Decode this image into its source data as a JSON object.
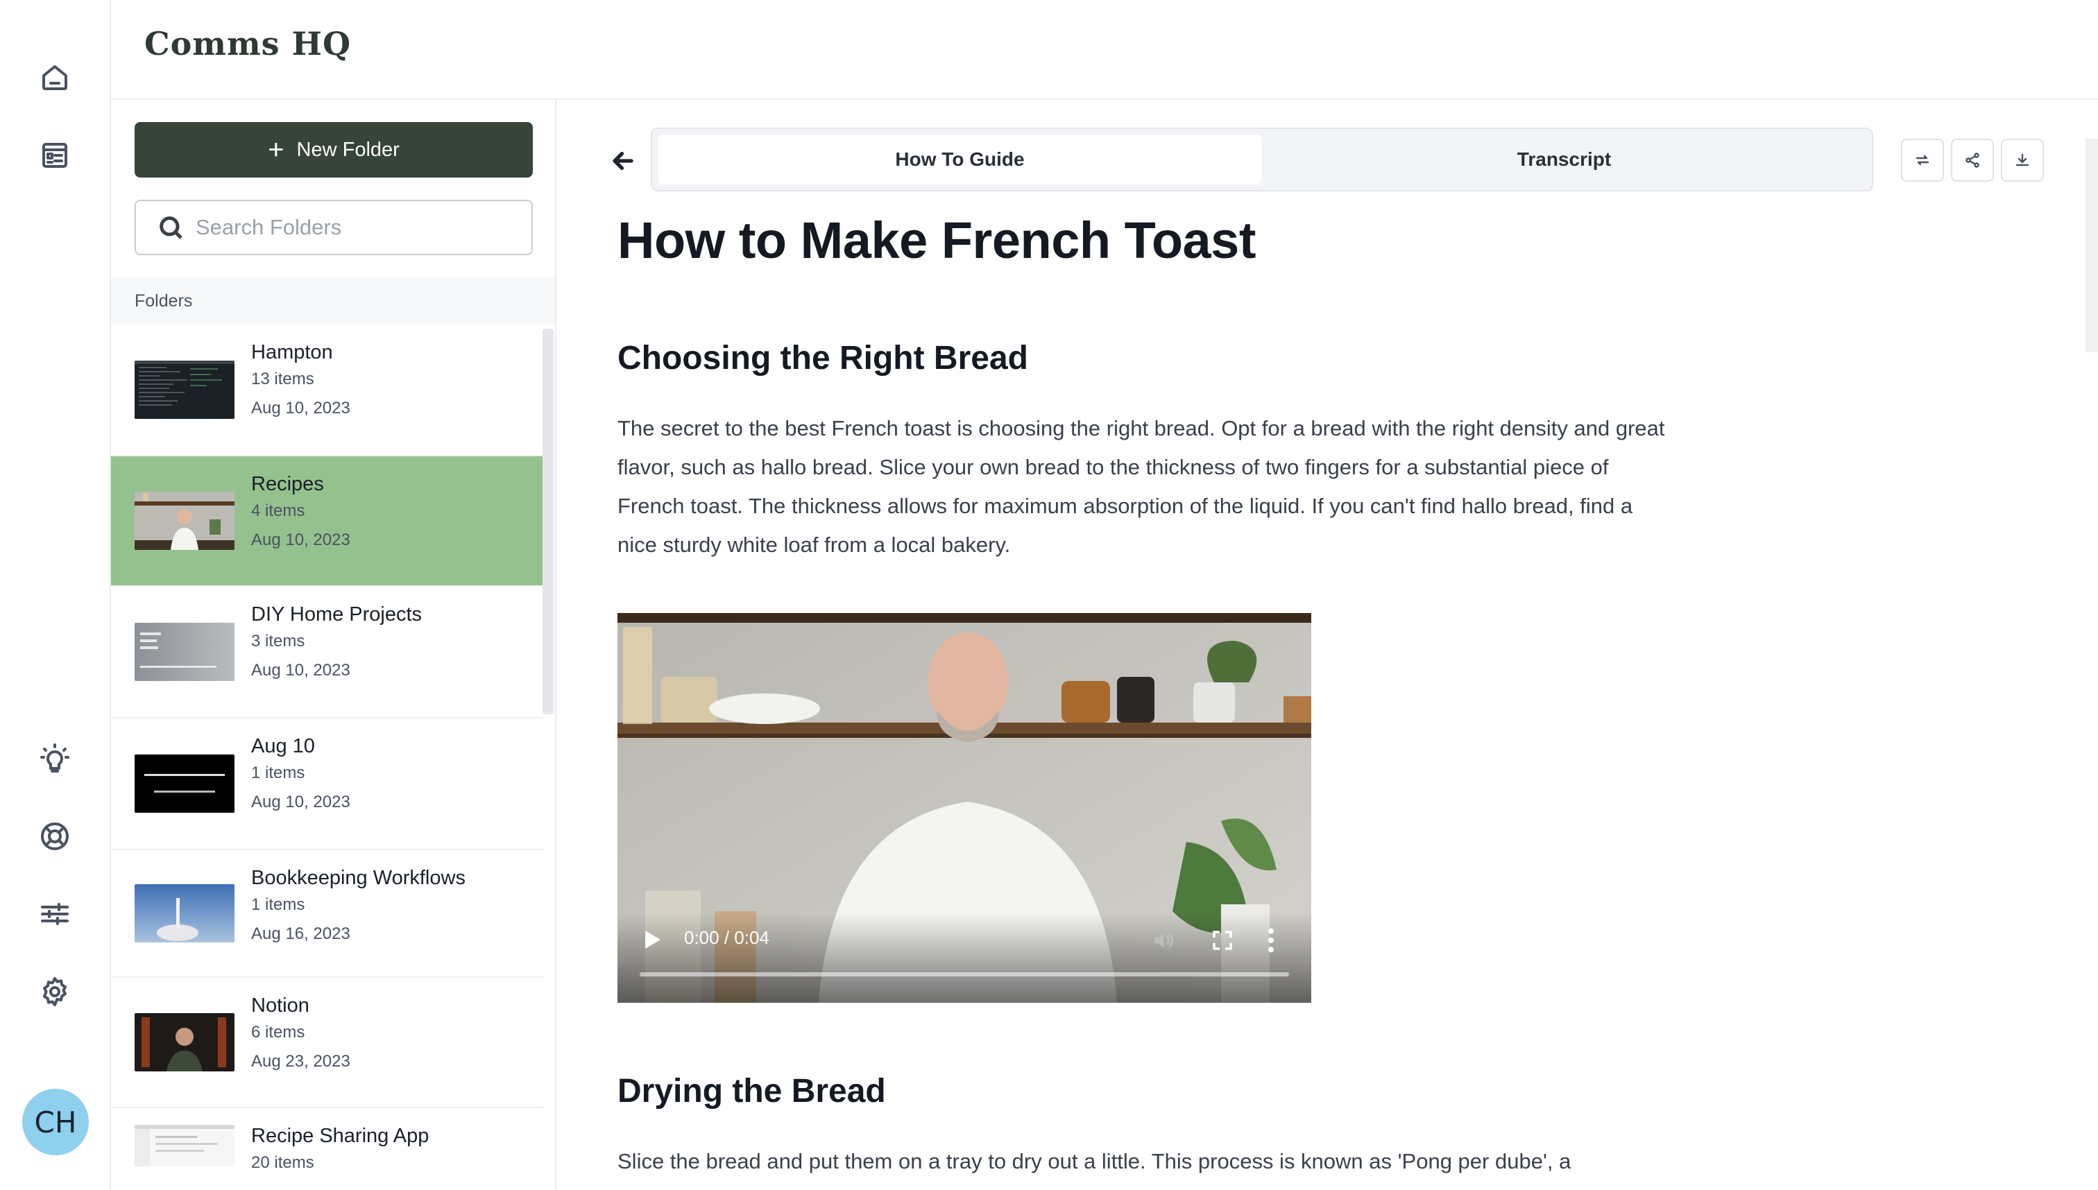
{
  "app": {
    "title": "Comms HQ"
  },
  "rail": {
    "avatar_initials": "CH",
    "top_icons": [
      "home-icon",
      "document-list-icon"
    ],
    "bottom_icons": [
      "lightbulb-icon",
      "help-lifebuoy-icon",
      "sliders-icon",
      "settings-gear-icon"
    ]
  },
  "sidebar": {
    "new_folder_label": "New Folder",
    "search_placeholder": "Search Folders",
    "section_label": "Folders",
    "folders": [
      {
        "name": "Hampton",
        "count": "13 items",
        "date": "Aug 10, 2023",
        "active": false
      },
      {
        "name": "Recipes",
        "count": "4 items",
        "date": "Aug 10, 2023",
        "active": true
      },
      {
        "name": "DIY Home Projects",
        "count": "3 items",
        "date": "Aug 10, 2023",
        "active": false
      },
      {
        "name": "Aug 10",
        "count": "1 items",
        "date": "Aug 10, 2023",
        "active": false
      },
      {
        "name": "Bookkeeping Workflows",
        "count": "1 items",
        "date": "Aug 16, 2023",
        "active": false
      },
      {
        "name": "Notion",
        "count": "6 items",
        "date": "Aug 23, 2023",
        "active": false
      },
      {
        "name": "Recipe Sharing App",
        "count": "20 items",
        "date": "",
        "active": false
      }
    ]
  },
  "main": {
    "tabs": [
      {
        "label": "How To Guide",
        "active": true
      },
      {
        "label": "Transcript",
        "active": false
      }
    ],
    "actions": [
      "refresh-icon",
      "share-icon",
      "download-icon"
    ],
    "doc": {
      "title": "How to Make French Toast",
      "section1_heading": "Choosing the Right Bread",
      "section1_body": "The secret to the best French toast is choosing the right bread. Opt for a bread with the right density and great flavor, such as hallo bread. Slice your own bread to the thickness of two fingers for a substantial piece of French toast. The thickness allows for maximum absorption of the liquid. If you can't find hallo bread, find a nice sturdy white loaf from a local bakery.",
      "video_time": "0:00 / 0:04",
      "video_progress": 0,
      "section2_heading": "Drying the Bread",
      "section2_body": "Slice the bread and put them on a tray to dry out a little. This process is known as 'Pong per dube', a"
    }
  }
}
